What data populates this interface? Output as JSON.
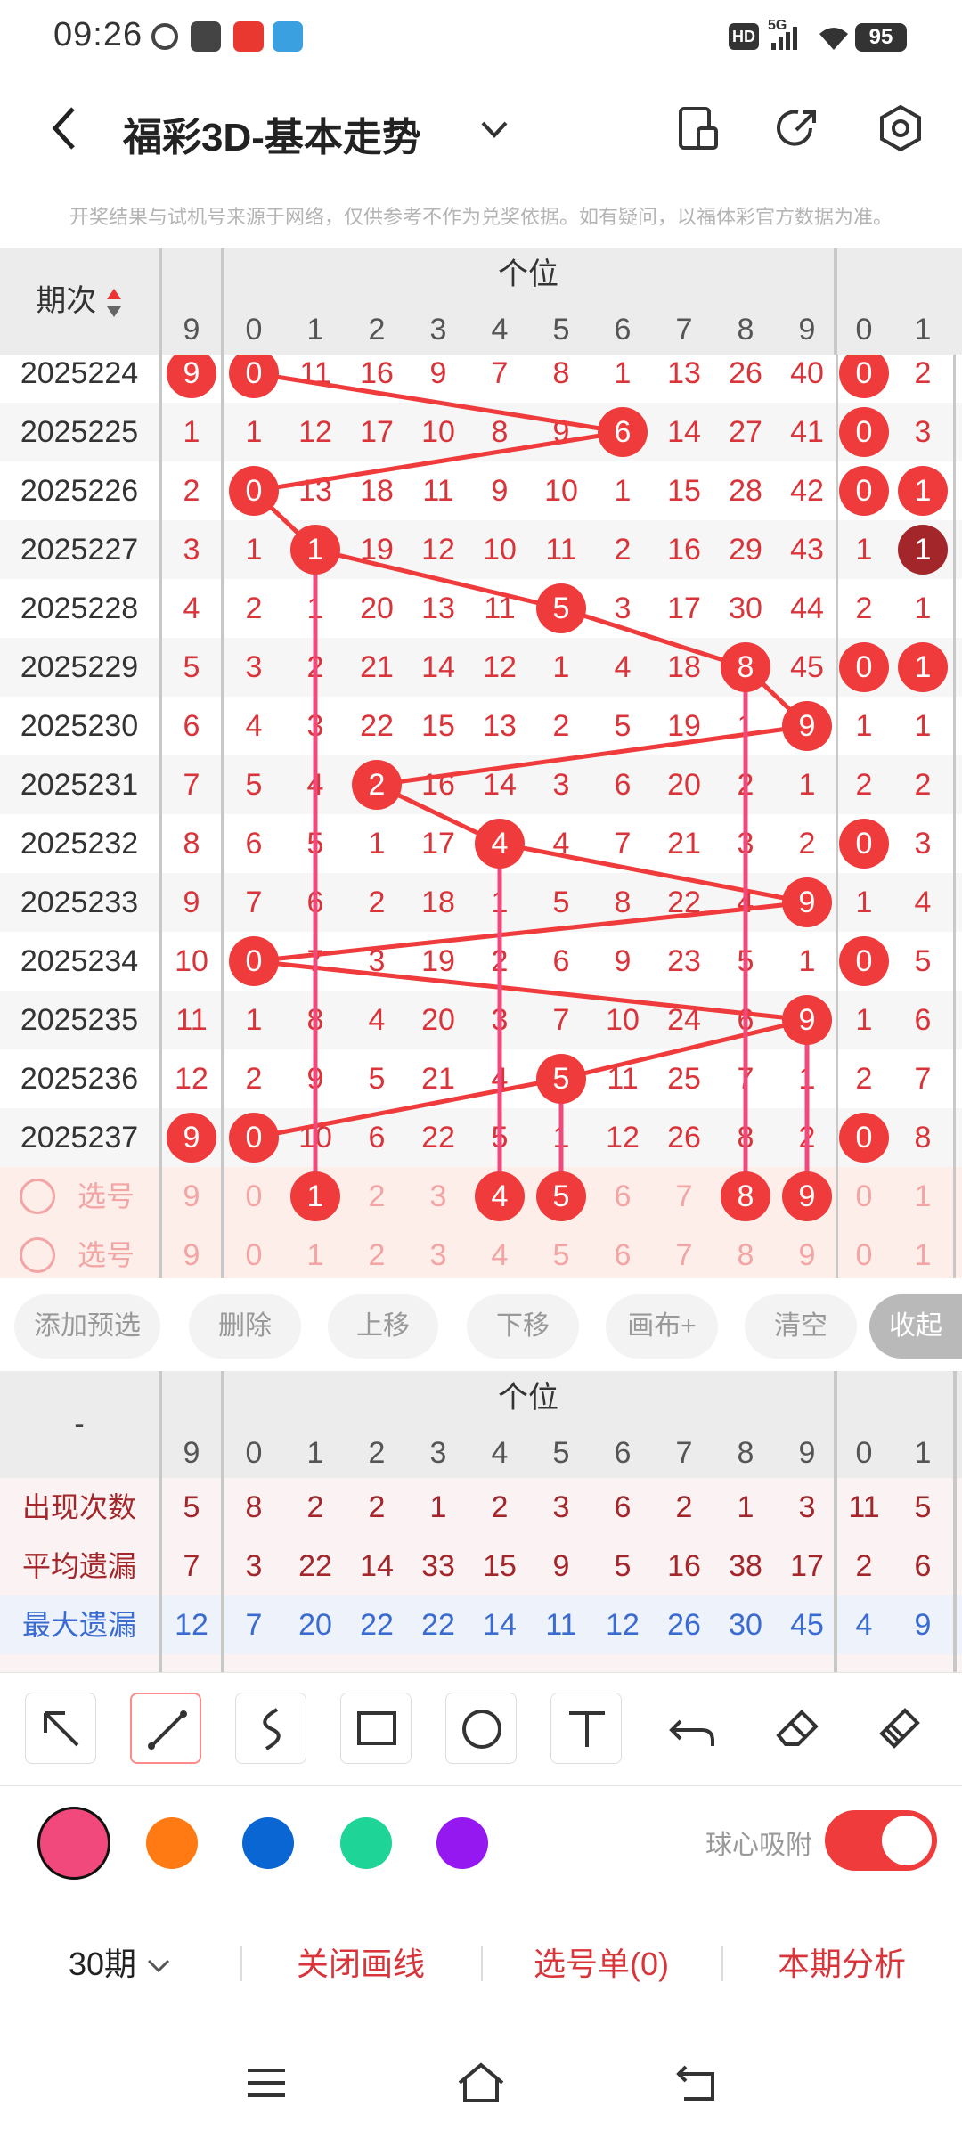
{
  "status": {
    "time": "09:26",
    "battery": "95",
    "hd": "HD",
    "network": "5G"
  },
  "header": {
    "title": "福彩3D-基本走势"
  },
  "disclaimer": "开奖结果与试机号来源于网络，仅供参考不作为兑奖依据。如有疑问，以福体彩官方数据为准。",
  "table": {
    "period_label": "期次",
    "group_label": "个位",
    "columns": [
      "9",
      "0",
      "1",
      "2",
      "3",
      "4",
      "5",
      "6",
      "7",
      "8",
      "9",
      "0",
      "1"
    ],
    "rows": [
      {
        "period": "2025224",
        "cells": [
          "9",
          "0",
          "11",
          "16",
          "9",
          "7",
          "8",
          "1",
          "13",
          "26",
          "40",
          "0",
          "2"
        ]
      },
      {
        "period": "2025225",
        "cells": [
          "1",
          "1",
          "12",
          "17",
          "10",
          "8",
          "9",
          "6",
          "14",
          "27",
          "41",
          "0",
          "3"
        ]
      },
      {
        "period": "2025226",
        "cells": [
          "2",
          "0",
          "13",
          "18",
          "11",
          "9",
          "10",
          "1",
          "15",
          "28",
          "42",
          "0",
          "1"
        ]
      },
      {
        "period": "2025227",
        "cells": [
          "3",
          "1",
          "1",
          "19",
          "12",
          "10",
          "11",
          "2",
          "16",
          "29",
          "43",
          "1",
          "1"
        ]
      },
      {
        "period": "2025228",
        "cells": [
          "4",
          "2",
          "1",
          "20",
          "13",
          "11",
          "5",
          "3",
          "17",
          "30",
          "44",
          "2",
          "1"
        ]
      },
      {
        "period": "2025229",
        "cells": [
          "5",
          "3",
          "2",
          "21",
          "14",
          "12",
          "1",
          "4",
          "18",
          "8",
          "45",
          "0",
          "1"
        ]
      },
      {
        "period": "2025230",
        "cells": [
          "6",
          "4",
          "3",
          "22",
          "15",
          "13",
          "2",
          "5",
          "19",
          "1",
          "9",
          "1",
          "1"
        ]
      },
      {
        "period": "2025231",
        "cells": [
          "7",
          "5",
          "4",
          "2",
          "16",
          "14",
          "3",
          "6",
          "20",
          "2",
          "1",
          "2",
          "2"
        ]
      },
      {
        "period": "2025232",
        "cells": [
          "8",
          "6",
          "5",
          "1",
          "17",
          "4",
          "4",
          "7",
          "21",
          "3",
          "2",
          "0",
          "3"
        ]
      },
      {
        "period": "2025233",
        "cells": [
          "9",
          "7",
          "6",
          "2",
          "18",
          "1",
          "5",
          "8",
          "22",
          "4",
          "9",
          "1",
          "4"
        ]
      },
      {
        "period": "2025234",
        "cells": [
          "10",
          "0",
          "7",
          "3",
          "19",
          "2",
          "6",
          "9",
          "23",
          "5",
          "1",
          "0",
          "5"
        ]
      },
      {
        "period": "2025235",
        "cells": [
          "11",
          "1",
          "8",
          "4",
          "20",
          "3",
          "7",
          "10",
          "24",
          "6",
          "9",
          "1",
          "6"
        ]
      },
      {
        "period": "2025236",
        "cells": [
          "12",
          "2",
          "9",
          "5",
          "21",
          "4",
          "5",
          "11",
          "25",
          "7",
          "1",
          "2",
          "7"
        ]
      },
      {
        "period": "2025237",
        "cells": [
          "9",
          "0",
          "10",
          "6",
          "22",
          "5",
          "1",
          "12",
          "26",
          "8",
          "2",
          "0",
          "8"
        ]
      }
    ],
    "select_label": "选号",
    "select_rows": [
      {
        "cells": [
          "9",
          "0",
          "1",
          "2",
          "3",
          "4",
          "5",
          "6",
          "7",
          "8",
          "9",
          "0",
          "1"
        ]
      },
      {
        "cells": [
          "9",
          "0",
          "1",
          "2",
          "3",
          "4",
          "5",
          "6",
          "7",
          "8",
          "9",
          "0",
          "1"
        ]
      }
    ]
  },
  "actions": {
    "add": "添加预选",
    "delete": "删除",
    "up": "上移",
    "down": "下移",
    "canvas": "画布+",
    "clear": "清空",
    "collapse": "收起"
  },
  "stats": {
    "dash": "-",
    "group_label": "个位",
    "columns": [
      "9",
      "0",
      "1",
      "2",
      "3",
      "4",
      "5",
      "6",
      "7",
      "8",
      "9",
      "0",
      "1"
    ],
    "rows": [
      {
        "label": "出现次数",
        "values": [
          "5",
          "8",
          "2",
          "2",
          "1",
          "2",
          "3",
          "6",
          "2",
          "1",
          "3",
          "11",
          "5"
        ]
      },
      {
        "label": "平均遗漏",
        "values": [
          "7",
          "3",
          "22",
          "14",
          "33",
          "15",
          "9",
          "5",
          "16",
          "38",
          "17",
          "2",
          "6"
        ]
      },
      {
        "label": "最大遗漏",
        "values": [
          "12",
          "7",
          "20",
          "22",
          "22",
          "14",
          "11",
          "12",
          "26",
          "30",
          "45",
          "4",
          "9"
        ]
      }
    ]
  },
  "tools": {
    "magnet_label": "球心吸附"
  },
  "colors": {
    "pink": "#f2497d",
    "orange": "#ff7a12",
    "blue": "#0a66d2",
    "green": "#1ed496",
    "purple": "#9618f0",
    "red": "#ef3b3b",
    "darkred": "#a3262a"
  },
  "bottom": {
    "period": "30期",
    "close_draw": "关闭画线",
    "pick_list": "选号单(0)",
    "analysis": "本期分析"
  }
}
